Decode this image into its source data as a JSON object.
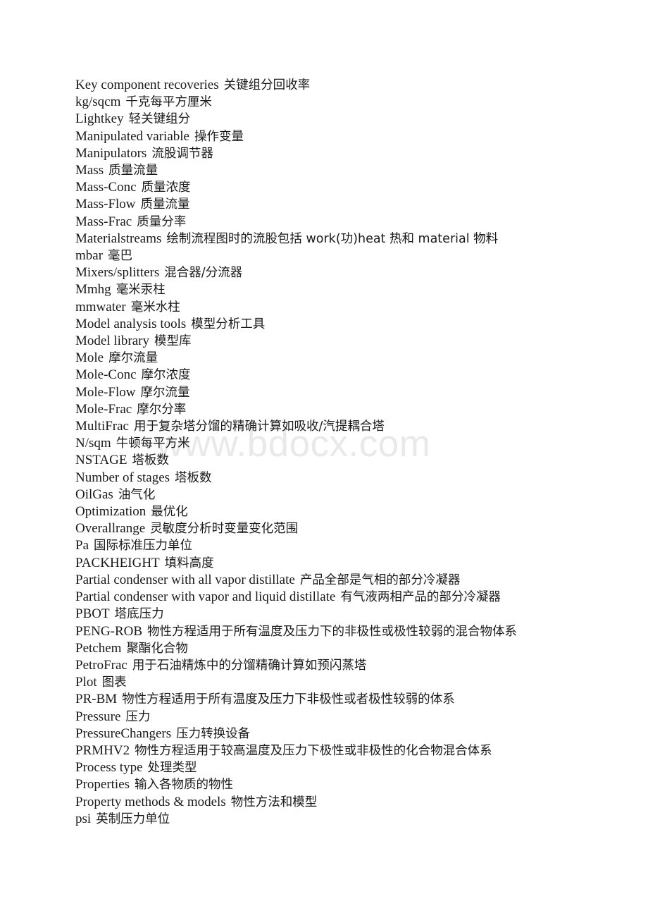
{
  "document": {
    "type": "bilingual-glossary",
    "watermark": "www.bdocx.com",
    "entries": [
      {
        "term": "Key component recoveries",
        "gloss": "关键组分回收率"
      },
      {
        "term": "kg/sqcm",
        "gloss": "千克每平方厘米"
      },
      {
        "term": "Lightkey",
        "gloss": "轻关键组分"
      },
      {
        "term": "Manipulated variable",
        "gloss": "操作变量"
      },
      {
        "term": "Manipulators",
        "gloss": "流股调节器"
      },
      {
        "term": "Mass",
        "gloss": "质量流量"
      },
      {
        "term": "Mass-Conc",
        "gloss": "质量浓度"
      },
      {
        "term": "Mass-Flow",
        "gloss": "质量流量"
      },
      {
        "term": "Mass-Frac",
        "gloss": "质量分率"
      },
      {
        "term": "Materialstreams",
        "gloss": "绘制流程图时的流股包括 work(功)heat 热和 material 物料"
      },
      {
        "term": "mbar",
        "gloss": "毫巴"
      },
      {
        "term": "Mixers/splitters",
        "gloss": "混合器/分流器"
      },
      {
        "term": "Mmhg",
        "gloss": "毫米汞柱"
      },
      {
        "term": "mmwater",
        "gloss": "毫米水柱"
      },
      {
        "term": "Model analysis tools",
        "gloss": "模型分析工具"
      },
      {
        "term": "Model library",
        "gloss": "模型库"
      },
      {
        "term": "Mole",
        "gloss": "摩尔流量"
      },
      {
        "term": "Mole-Conc",
        "gloss": "摩尔浓度"
      },
      {
        "term": "Mole-Flow",
        "gloss": "摩尔流量"
      },
      {
        "term": "Mole-Frac",
        "gloss": "摩尔分率"
      },
      {
        "term": "MultiFrac",
        "gloss": "用于复杂塔分馏的精确计算如吸收/汽提耦合塔"
      },
      {
        "term": "N/sqm",
        "gloss": "牛顿每平方米"
      },
      {
        "term": "NSTAGE",
        "gloss": "塔板数"
      },
      {
        "term": "Number of stages",
        "gloss": "塔板数"
      },
      {
        "term": "OilGas",
        "gloss": "油气化"
      },
      {
        "term": "Optimization",
        "gloss": "最优化"
      },
      {
        "term": "Overallrange",
        "gloss": "灵敏度分析时变量变化范围"
      },
      {
        "term": "Pa",
        "gloss": "国际标准压力单位"
      },
      {
        "term": "PACKHEIGHT",
        "gloss": "填料高度"
      },
      {
        "term": "Partial condenser with all vapor distillate",
        "gloss": "产品全部是气相的部分冷凝器"
      },
      {
        "term": "Partial condenser with vapor and liquid distillate",
        "gloss": "有气液两相产品的部分冷凝器"
      },
      {
        "term": "PBOT",
        "gloss": "塔底压力"
      },
      {
        "term": "PENG-ROB",
        "gloss": "物性方程适用于所有温度及压力下的非极性或极性较弱的混合物体系"
      },
      {
        "term": "Petchem",
        "gloss": "聚酯化合物"
      },
      {
        "term": "PetroFrac",
        "gloss": "用于石油精炼中的分馏精确计算如预闪蒸塔"
      },
      {
        "term": "Plot",
        "gloss": "图表"
      },
      {
        "term": "PR-BM",
        "gloss": "物性方程适用于所有温度及压力下非极性或者极性较弱的体系"
      },
      {
        "term": "Pressure",
        "gloss": "压力"
      },
      {
        "term": "PressureChangers",
        "gloss": "压力转换设备"
      },
      {
        "term": "PRMHV2",
        "gloss": "物性方程适用于较高温度及压力下极性或非极性的化合物混合体系"
      },
      {
        "term": "Process type",
        "gloss": "处理类型"
      },
      {
        "term": "Properties",
        "gloss": "输入各物质的物性"
      },
      {
        "term": "Property methods & models",
        "gloss": "物性方法和模型"
      },
      {
        "term": "psi",
        "gloss": "英制压力单位"
      }
    ]
  }
}
